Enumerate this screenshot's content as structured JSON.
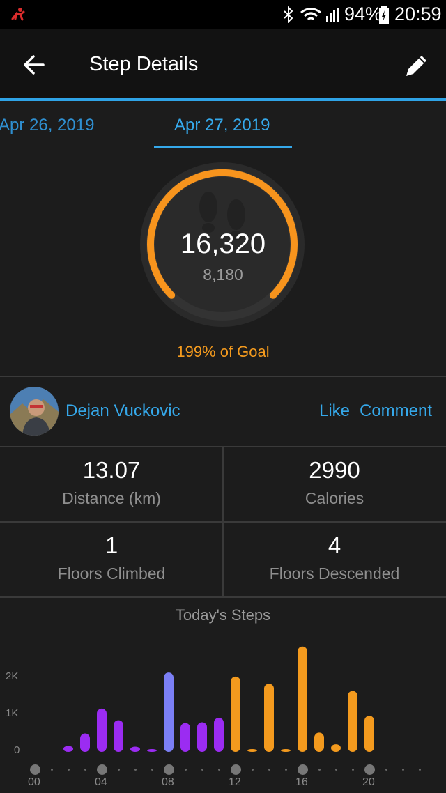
{
  "status_bar": {
    "battery": "94%",
    "time": "20:59"
  },
  "header": {
    "title": "Step Details"
  },
  "tabs": [
    {
      "label": "Apr 26, 2019",
      "active": false
    },
    {
      "label": "Apr 27, 2019",
      "active": true
    }
  ],
  "summary": {
    "steps": "16,320",
    "goal": "8,180",
    "percent_text": "199% of Goal",
    "ring_fraction": 1.0
  },
  "user": {
    "name": "Dejan Vuckovic",
    "like": "Like",
    "comment": "Comment"
  },
  "stats": [
    {
      "value": "13.07",
      "label": "Distance (km)"
    },
    {
      "value": "2990",
      "label": "Calories"
    },
    {
      "value": "1",
      "label": "Floors Climbed"
    },
    {
      "value": "4",
      "label": "Floors Descended"
    }
  ],
  "colors": {
    "accent": "#35a8ea",
    "goal_orange": "#f39a1e",
    "bar_purple": "#9b2cf2",
    "bar_blue": "#7b7ff5"
  },
  "chart_data": {
    "type": "bar",
    "title": "Today's Steps",
    "xlabel": "",
    "ylabel": "",
    "x_ticks": [
      "00",
      "04",
      "08",
      "12",
      "16",
      "20"
    ],
    "y_ticks": [
      "0",
      "1K",
      "2K"
    ],
    "ylim": [
      0,
      2800
    ],
    "bars": [
      {
        "hour": 2,
        "value": 150,
        "color": "#9b2cf2"
      },
      {
        "hour": 3,
        "value": 460,
        "color": "#9b2cf2"
      },
      {
        "hour": 4,
        "value": 1080,
        "color": "#9b2cf2"
      },
      {
        "hour": 5,
        "value": 790,
        "color": "#9b2cf2"
      },
      {
        "hour": 6,
        "value": 130,
        "color": "#9b2cf2"
      },
      {
        "hour": 7,
        "value": 30,
        "color": "#9b2cf2"
      },
      {
        "hour": 8,
        "value": 1980,
        "color": "#7b7ff5"
      },
      {
        "hour": 9,
        "value": 720,
        "color": "#9b2cf2"
      },
      {
        "hour": 10,
        "value": 740,
        "color": "#9b2cf2"
      },
      {
        "hour": 11,
        "value": 850,
        "color": "#9b2cf2"
      },
      {
        "hour": 12,
        "value": 1880,
        "color": "#f39a1e"
      },
      {
        "hour": 13,
        "value": 20,
        "color": "#f39a1e"
      },
      {
        "hour": 14,
        "value": 1700,
        "color": "#f39a1e"
      },
      {
        "hour": 15,
        "value": 30,
        "color": "#f39a1e"
      },
      {
        "hour": 16,
        "value": 2630,
        "color": "#f39a1e"
      },
      {
        "hour": 17,
        "value": 480,
        "color": "#f39a1e"
      },
      {
        "hour": 18,
        "value": 190,
        "color": "#f39a1e"
      },
      {
        "hour": 19,
        "value": 1520,
        "color": "#f39a1e"
      },
      {
        "hour": 20,
        "value": 900,
        "color": "#f39a1e"
      }
    ]
  }
}
